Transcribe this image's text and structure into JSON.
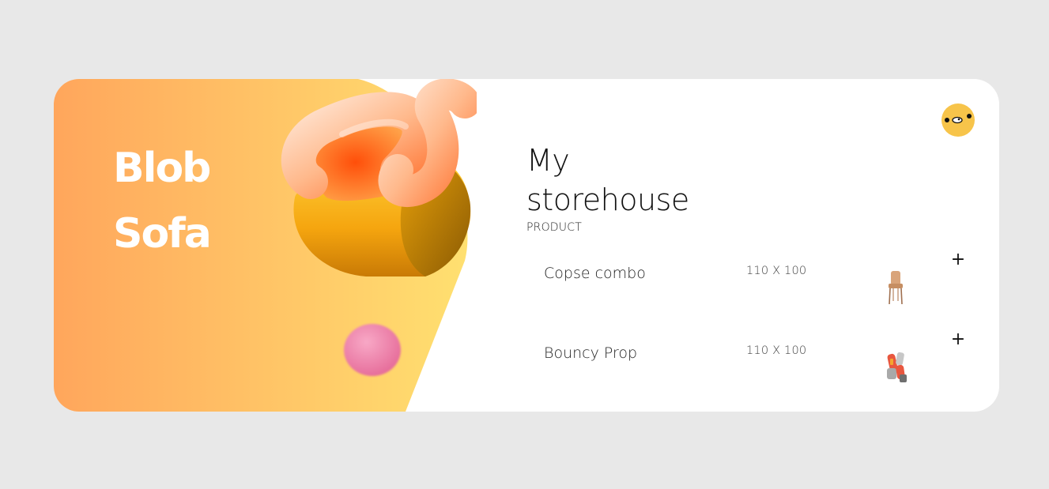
{
  "hero": {
    "title": "Blob\nSofa",
    "colors": {
      "gradient_start": "#ffa65c",
      "gradient_end": "#ffe070",
      "ball": "#ec7fa6"
    },
    "image": "blob-sofa-3d-render"
  },
  "user": {
    "avatar": "cartoon-face-avatar",
    "color": "#f7c44a"
  },
  "storehouse": {
    "title_line1": "My",
    "title_line2": "storehouse",
    "section_label": "PRODUCT"
  },
  "products": [
    {
      "name": "Copse combo",
      "size": "110 X 100",
      "thumbnail": "wooden-chair-thumbnail",
      "add_label": "+"
    },
    {
      "name": "Bouncy Prop",
      "size": "110 X 100",
      "thumbnail": "colorful-prop-thumbnail",
      "add_label": "+"
    }
  ]
}
